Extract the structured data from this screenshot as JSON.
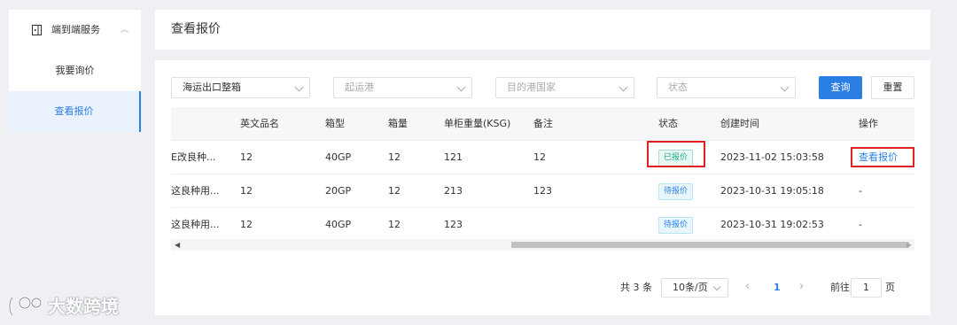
{
  "sidebar": {
    "group_title": "端到端服务",
    "items": [
      {
        "label": "我要询价"
      },
      {
        "label": "查看报价"
      }
    ]
  },
  "header": {
    "title": "查看报价"
  },
  "filters": {
    "type_value": "海运出口整箱",
    "origin_placeholder": "起运港",
    "dest_placeholder": "目的港国家",
    "status_placeholder": "状态",
    "query_label": "查询",
    "reset_label": "重置"
  },
  "table": {
    "columns": [
      "英文品名",
      "箱型",
      "箱量",
      "单柜重量(KSG)",
      "备注",
      "状态",
      "创建时间",
      "操作"
    ],
    "rows": [
      {
        "name_cut": "E改良种...",
        "english": "12",
        "box": "40GP",
        "qty": "12",
        "weight": "121",
        "note": "12",
        "status": "已报价",
        "created": "2023-11-02 15:03:58",
        "action": "查看报价"
      },
      {
        "name_cut": "这良种用...",
        "english": "12",
        "box": "20GP",
        "qty": "12",
        "weight": "213",
        "note": "123",
        "status": "待报价",
        "created": "2023-10-31 19:05:18",
        "action": "-"
      },
      {
        "name_cut": "这良种用...",
        "english": "12",
        "box": "40GP",
        "qty": "12",
        "weight": "123",
        "note": "",
        "status": "待报价",
        "created": "2023-10-31 19:02:53",
        "action": "-"
      }
    ]
  },
  "pagination": {
    "total": "共 3 条",
    "page_size": "10条/页",
    "current": "1",
    "goto_label": "前往",
    "goto_value": "1",
    "goto_unit": "页"
  },
  "watermark": {
    "text": "大数跨境"
  },
  "colors": {
    "accent": "#2b7fe3",
    "highlight_box": "#e02020",
    "done_tag": "#1fa98a"
  }
}
